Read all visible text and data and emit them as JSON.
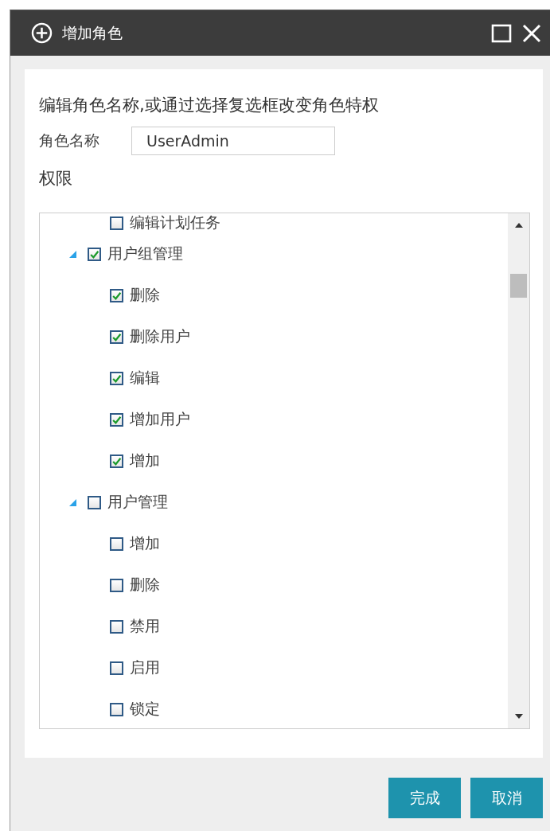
{
  "window": {
    "title": "增加角色"
  },
  "instructions": "编辑角色名称,或通过选择复选框改变角色特权",
  "role_name": {
    "label": "角色名称",
    "value": "UserAdmin"
  },
  "permissions": {
    "label": "权限",
    "tree": [
      {
        "children": [
          {
            "label": "编辑计划任务",
            "checked": false
          }
        ]
      },
      {
        "label": "用户组管理",
        "checked": true,
        "expanded": true,
        "children": [
          {
            "label": "删除",
            "checked": true
          },
          {
            "label": "删除用户",
            "checked": true
          },
          {
            "label": "编辑",
            "checked": true
          },
          {
            "label": "增加用户",
            "checked": true
          },
          {
            "label": "增加",
            "checked": true
          }
        ]
      },
      {
        "label": "用户管理",
        "checked": false,
        "expanded": true,
        "children": [
          {
            "label": "增加",
            "checked": false
          },
          {
            "label": "删除",
            "checked": false
          },
          {
            "label": "禁用",
            "checked": false
          },
          {
            "label": "启用",
            "checked": false
          },
          {
            "label": "锁定",
            "checked": false
          }
        ]
      }
    ]
  },
  "buttons": [
    {
      "label": "完成"
    },
    {
      "label": "取消"
    }
  ]
}
